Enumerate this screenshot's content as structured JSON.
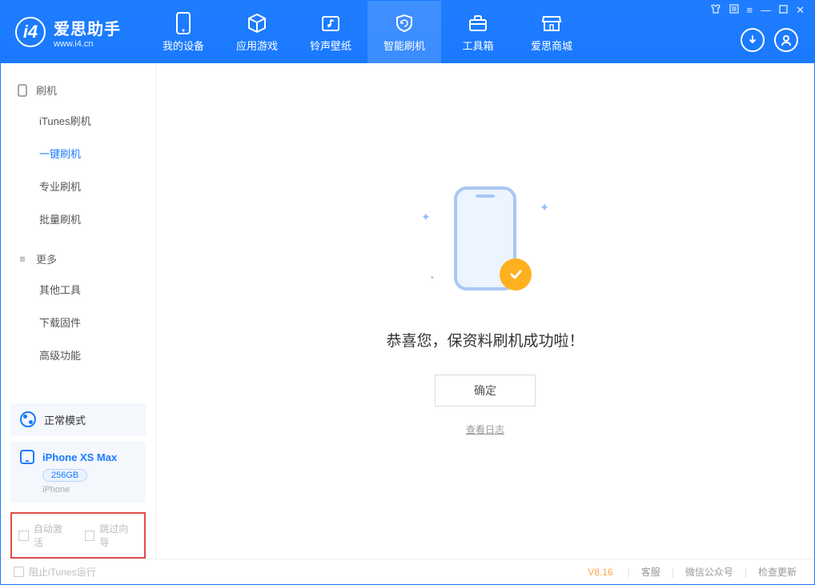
{
  "app": {
    "name_cn": "爱思助手",
    "name_en": "www.i4.cn"
  },
  "tabs": [
    {
      "label": "我的设备"
    },
    {
      "label": "应用游戏"
    },
    {
      "label": "铃声壁纸"
    },
    {
      "label": "智能刷机"
    },
    {
      "label": "工具箱"
    },
    {
      "label": "爱思商城"
    }
  ],
  "sidebar": {
    "group1_title": "刷机",
    "group1_items": [
      {
        "label": "iTunes刷机"
      },
      {
        "label": "一键刷机"
      },
      {
        "label": "专业刷机"
      },
      {
        "label": "批量刷机"
      }
    ],
    "group2_title": "更多",
    "group2_items": [
      {
        "label": "其他工具"
      },
      {
        "label": "下载固件"
      },
      {
        "label": "高级功能"
      }
    ],
    "mode_label": "正常模式",
    "device": {
      "name": "iPhone XS Max",
      "capacity": "256GB",
      "type": "iPhone"
    },
    "options": {
      "auto_activate": "自动激活",
      "skip_guide": "跳过向导"
    }
  },
  "main": {
    "success_msg": "恭喜您，保资料刷机成功啦！",
    "ok_btn": "确定",
    "view_log": "查看日志"
  },
  "footer": {
    "block_itunes": "阻止iTunes运行",
    "version": "V8.16",
    "links": {
      "service": "客服",
      "wechat": "微信公众号",
      "update": "检查更新"
    }
  }
}
